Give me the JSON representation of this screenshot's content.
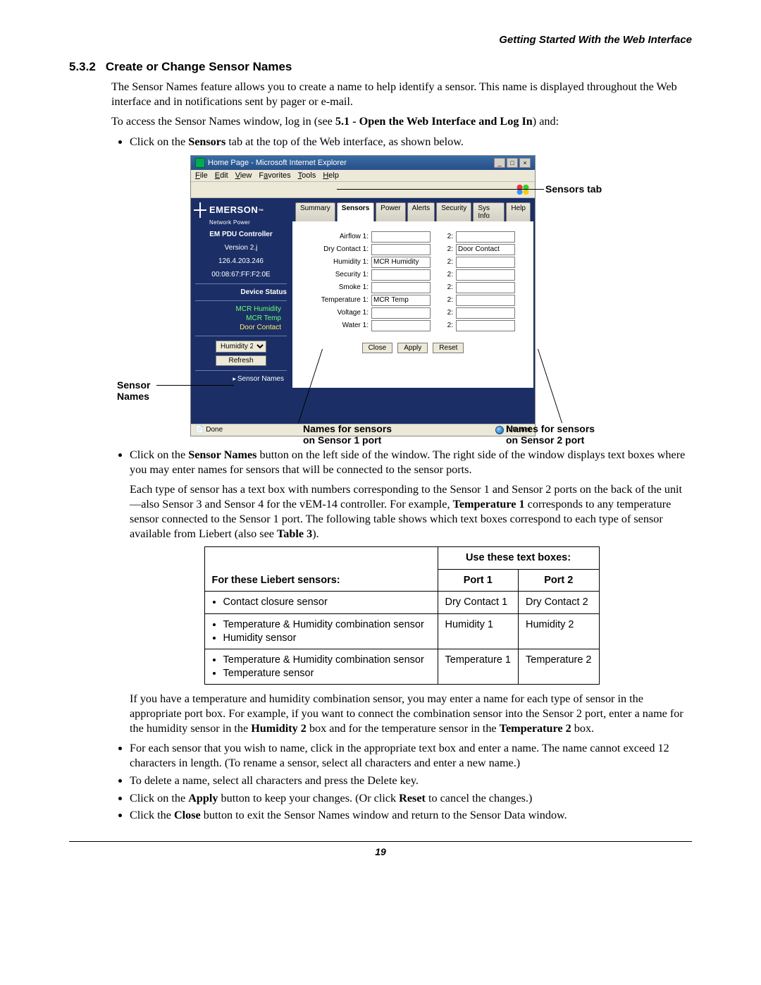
{
  "running_head": "Getting Started With the Web Interface",
  "section": {
    "number": "5.3.2",
    "title": "Create or Change Sensor Names"
  },
  "para_intro": "The Sensor Names feature allows you to create a name to help identify a sensor. This name is displayed throughout the Web interface and in notifications sent by pager or e-mail.",
  "para_access_pre": "To access the Sensor Names window, log in (see ",
  "para_access_bold": "5.1 - Open the Web Interface and Log In",
  "para_access_post": ") and:",
  "bullet_click_sensors_pre": "Click on the ",
  "bullet_click_sensors_bold": "Sensors",
  "bullet_click_sensors_post": " tab at the top of the Web interface, as shown below.",
  "callouts": {
    "sensors_tab": "Sensors tab",
    "sensor_names_l1": "Sensor",
    "sensor_names_l2": "Names",
    "port1_l1": "Names for sensors",
    "port1_l2": "on Sensor 1 port",
    "port2_l1": "Names for sensors",
    "port2_l2": "on Sensor 2 port"
  },
  "ie": {
    "title": "Home Page - Microsoft Internet Explorer",
    "menu": {
      "file": "File",
      "edit": "Edit",
      "view": "View",
      "favorites": "Favorites",
      "tools": "Tools",
      "help": "Help"
    },
    "status_left": "Done",
    "status_right": "Internet"
  },
  "brand": {
    "name": "EMERSON",
    "sub": "Network Power"
  },
  "controller": {
    "name": "EM PDU Controller",
    "version": "Version 2.j",
    "ip": "126.4.203.246",
    "mac": "00:08:67:FF:F2:0E"
  },
  "sidebar": {
    "device_status": "Device Status",
    "devices": {
      "d1": "MCR Humidity",
      "d2": "MCR Temp",
      "d3": "Door Contact"
    },
    "select_value": "Humidity 2",
    "refresh": "Refresh",
    "sensor_names": "Sensor Names"
  },
  "tabs": {
    "summary": "Summary",
    "sensors": "Sensors",
    "power": "Power",
    "alerts": "Alerts",
    "security": "Security",
    "sysinfo": "Sys Info",
    "help": "Help"
  },
  "sensors": {
    "col1_labels": {
      "airflow": "Airflow 1:",
      "drycontact": "Dry Contact 1:",
      "humidity": "Humidity 1:",
      "security": "Security 1:",
      "smoke": "Smoke 1:",
      "temperature": "Temperature 1:",
      "voltage": "Voltage 1:",
      "water": "Water 1:"
    },
    "col1_values": {
      "humidity": "MCR Humidity",
      "temperature": "MCR Temp"
    },
    "col2_label": "2:",
    "col2_values": {
      "drycontact": "Door Contact"
    },
    "btn_close": "Close",
    "btn_apply": "Apply",
    "btn_reset": "Reset"
  },
  "after_fig": {
    "p1_pre": "Click on the ",
    "p1_bold": "Sensor Names",
    "p1_post": " button on the left side of the window. The right side of the window displays text boxes where you may enter names for sensors that will be connected to the sensor ports.",
    "p2_a": "Each type of sensor has a text box with numbers corresponding to the Sensor 1 and Sensor 2 ports on the back of the unit—also Sensor 3 and Sensor 4 for the vEM-14 controller. For example, ",
    "p2_b": "Temperature 1",
    "p2_c": " corresponds to any temperature sensor connected to the Sensor 1 port. The following table shows which text boxes correspond to each type of sensor available from Liebert (also see ",
    "p2_d": "Table 3",
    "p2_e": ")."
  },
  "table": {
    "h0": "For these Liebert sensors:",
    "h_group": "Use these text boxes:",
    "h1": "Port 1",
    "h2": "Port 2",
    "r1_c0": "Contact closure sensor",
    "r1_c1": "Dry Contact 1",
    "r1_c2": "Dry Contact 2",
    "r2_c0a": "Temperature & Humidity combination sensor",
    "r2_c0b": "Humidity sensor",
    "r2_c1": "Humidity 1",
    "r2_c2": "Humidity 2",
    "r3_c0a": "Temperature & Humidity combination sensor",
    "r3_c0b": "Temperature sensor",
    "r3_c1": "Temperature 1",
    "r3_c2": "Temperature 2"
  },
  "after_table": {
    "p1_a": "If you have a temperature and humidity combination sensor, you may enter a name for each type of sensor in the appropriate port box. For example, if you want to connect the combination sensor into the Sensor 2 port, enter a name for the humidity sensor in the ",
    "p1_b": "Humidity 2",
    "p1_c": " box and for the temperature sensor in the ",
    "p1_d": "Temperature 2",
    "p1_e": " box.",
    "b2": "For each sensor that you wish to name, click in the appropriate text box and enter a name. The name cannot exceed 12 characters in length. (To rename a sensor, select all characters and enter a new name.)",
    "b3": "To delete a name, select all characters and press the Delete key.",
    "b4_a": "Click on the ",
    "b4_b": "Apply",
    "b4_c": " button to keep your changes. (Or click ",
    "b4_d": "Reset",
    "b4_e": " to cancel the changes.)",
    "b5_a": "Click the ",
    "b5_b": "Close",
    "b5_c": " button to exit the Sensor Names window and return to the Sensor Data window."
  },
  "page_number": "19"
}
